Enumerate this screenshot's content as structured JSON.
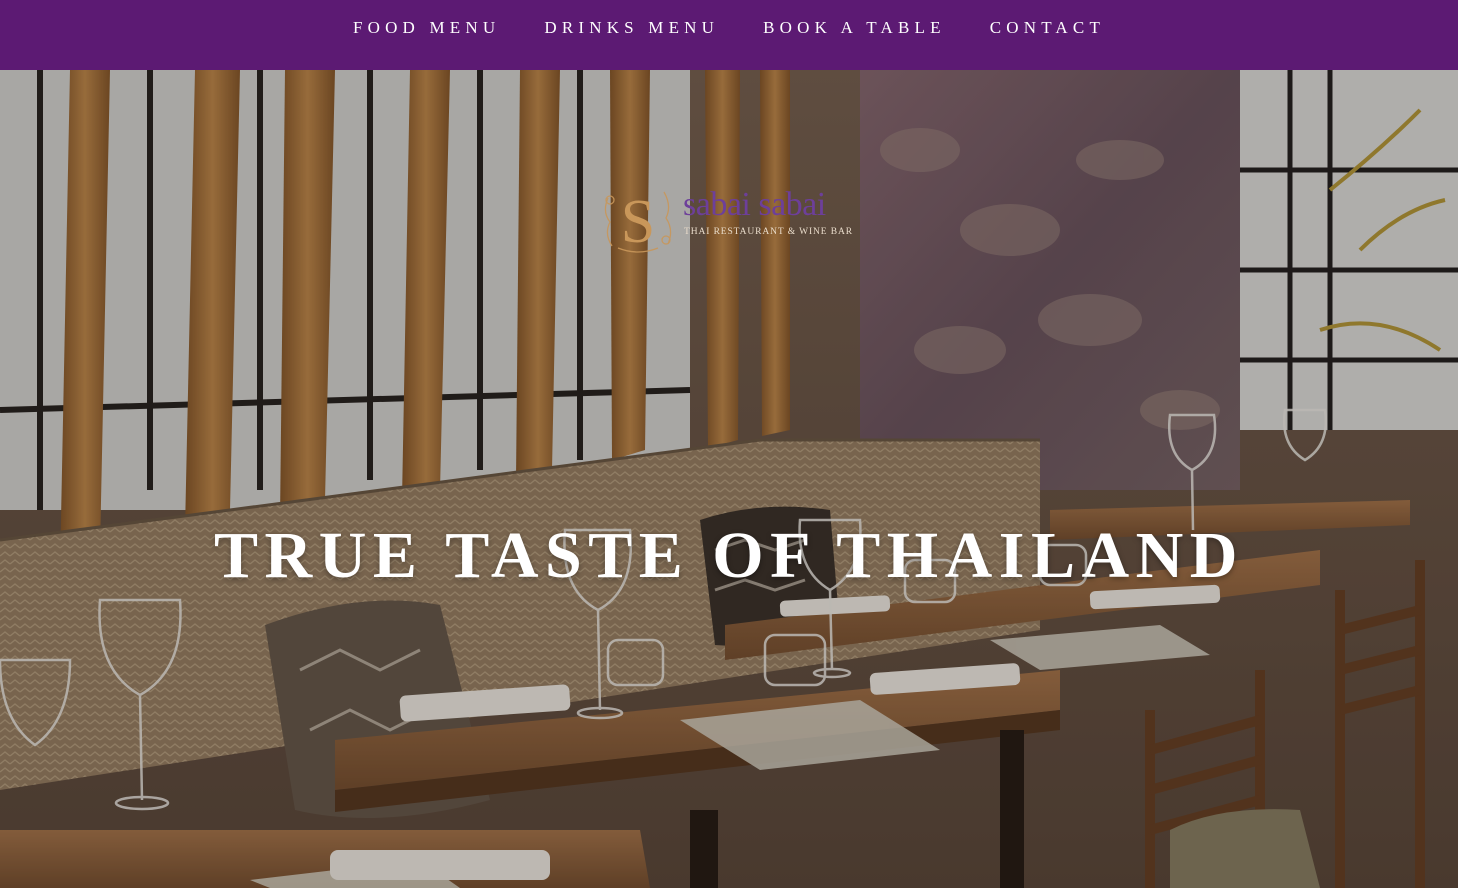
{
  "nav": {
    "items": [
      {
        "label": "FOOD MENU"
      },
      {
        "label": "DRINKS MENU"
      },
      {
        "label": "BOOK A TABLE"
      },
      {
        "label": "CONTACT"
      }
    ]
  },
  "brand": {
    "name": "sabai sabai",
    "tagline": "THAI RESTAURANT & WINE BAR",
    "monogram": "S"
  },
  "hero": {
    "headline": "TRUE TASTE OF THAILAND"
  },
  "colors": {
    "nav_background": "#5c1a73",
    "brand_purple": "#6d3f9a",
    "logo_gold": "#c9975a"
  }
}
